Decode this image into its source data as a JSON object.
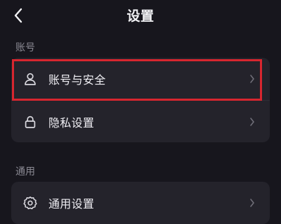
{
  "header": {
    "title": "设置",
    "back_icon": "chevron-left-icon"
  },
  "sections": [
    {
      "title": "账号",
      "items": [
        {
          "label": "账号与安全",
          "icon": "user-icon",
          "highlighted": true
        },
        {
          "label": "隐私设置",
          "icon": "lock-icon",
          "highlighted": false
        }
      ]
    },
    {
      "title": "通用",
      "items": [
        {
          "label": "通用设置",
          "icon": "gear-icon",
          "highlighted": false
        }
      ]
    }
  ],
  "colors": {
    "background": "#17161d",
    "card": "#24232b",
    "highlight": "#d8262f",
    "section_title": "#8b8a94"
  }
}
